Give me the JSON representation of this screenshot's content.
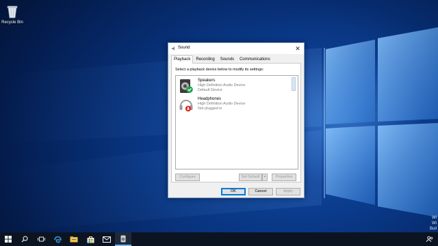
{
  "desktop": {
    "recycle_bin_label": "Recycle Bin",
    "corner_text": [
      "Wi",
      "Wi",
      "Buil"
    ]
  },
  "dialog": {
    "title": "Sound",
    "close_glyph": "✕",
    "tabs": [
      "Playback",
      "Recording",
      "Sounds",
      "Communications"
    ],
    "active_tab": "Playback",
    "instruction": "Select a playback device below to modify its settings:",
    "devices": [
      {
        "name": "Speakers",
        "driver": "High Definition Audio Device",
        "status": "Default Device",
        "icon": "speaker-icon",
        "badge": "default-check-badge",
        "badge_color": "#1ea446"
      },
      {
        "name": "Headphones",
        "driver": "High Definition Audio Device",
        "status": "Not plugged in",
        "icon": "headphones-icon",
        "badge": "unplugged-badge",
        "badge_color": "#d9302a"
      }
    ],
    "buttons": {
      "configure": "Configure",
      "set_default": "Set Default",
      "dropdown_glyph": "▾",
      "properties": "Properties",
      "ok": "OK",
      "cancel": "Cancel",
      "apply": "Apply"
    }
  },
  "taskbar": {
    "items": [
      "start-icon",
      "search-icon",
      "task-view-icon",
      "edge-icon",
      "file-explorer-icon",
      "store-icon",
      "mail-icon",
      "sound-app-icon"
    ],
    "accent_color": "#76b9ed"
  },
  "colors": {
    "desktop_blue": "#0f4aa8",
    "dialog_border": "#7a9cc6",
    "default_button_border": "#0078d7"
  }
}
